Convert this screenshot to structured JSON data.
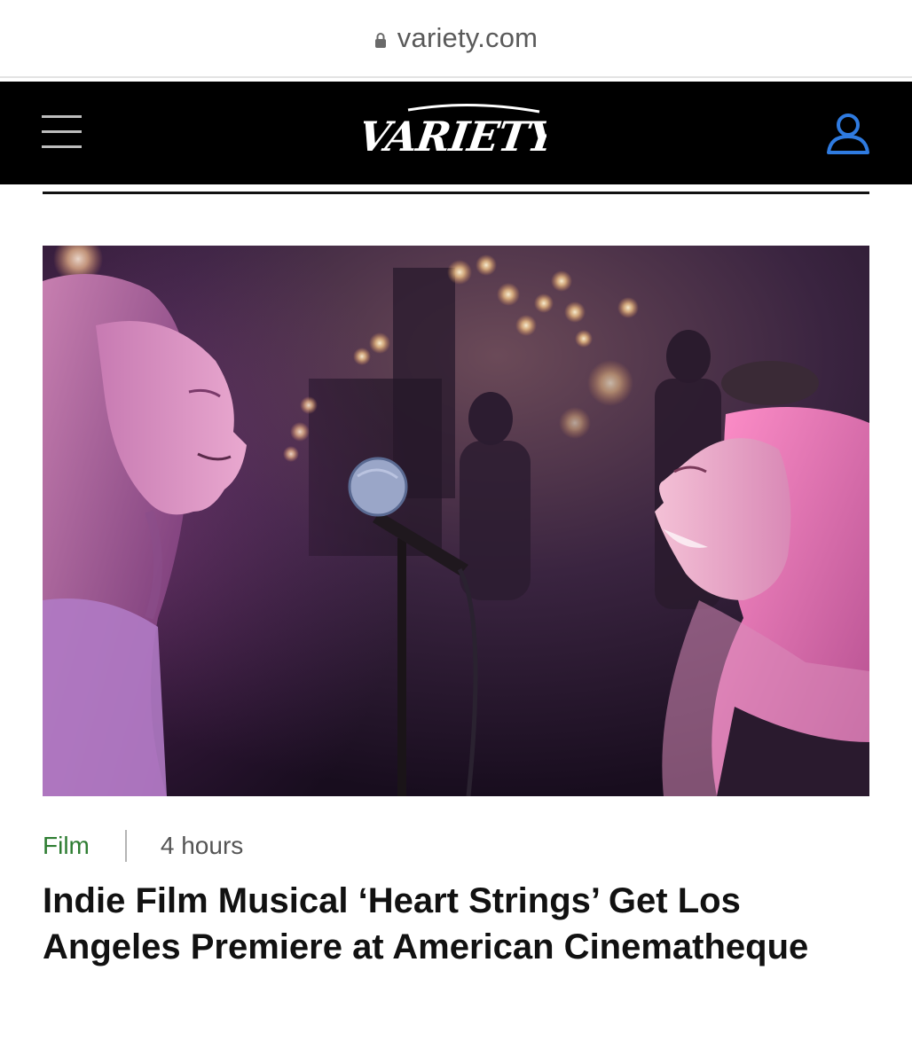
{
  "browser": {
    "url": "variety.com",
    "icons": {
      "lock": "lock-icon"
    }
  },
  "header": {
    "logo_text": "VARIETY",
    "icons": {
      "menu": "hamburger-menu-icon",
      "account": "user-account-icon"
    },
    "colors": {
      "background": "#000000",
      "logo": "#ffffff",
      "account_icon": "#2f7be0"
    }
  },
  "article": {
    "category": "Film",
    "time_ago": "4 hours",
    "headline": "Indie Film Musical ‘Heart Strings’ Get Los Angeles Premiere at American Cinematheque",
    "colors": {
      "category": "#2e7d32",
      "headline": "#111111"
    }
  }
}
